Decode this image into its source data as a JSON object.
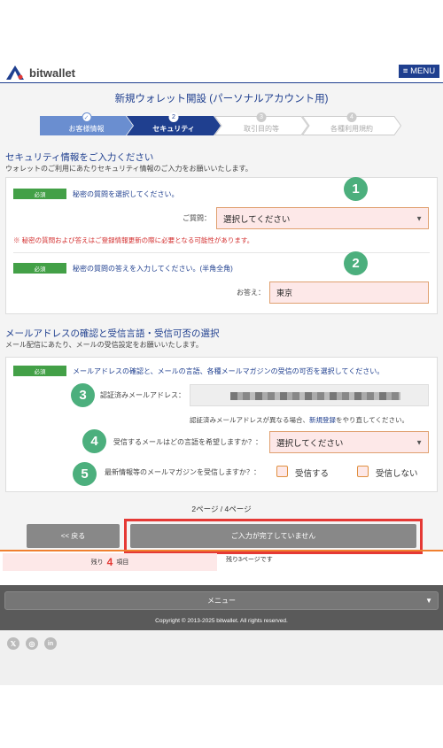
{
  "header": {
    "brand": "bitwallet",
    "menu_label": "≡ MENU"
  },
  "page_title": "新規ウォレット開設 (パーソナルアカウント用)",
  "steps": [
    {
      "num": "✓",
      "label": "お客様情報",
      "state": "done"
    },
    {
      "num": "2",
      "label": "セキュリティ",
      "state": "current"
    },
    {
      "num": "3",
      "label": "取引目的等",
      "state": "todo"
    },
    {
      "num": "4",
      "label": "各種利用規約",
      "state": "todo"
    }
  ],
  "security": {
    "title": "セキュリティ情報をご入力ください",
    "desc": "ウォレットのご利用にあたりセキュリティ情報のご入力をお願いいたします。",
    "q1": {
      "badge": "必須",
      "text": "秘密の質問を選択してください。",
      "label": "ご質問：",
      "select_value": "選択してください",
      "warning": "※ 秘密の質問および答えはご登録情報更新の際に必要となる可能性があります。",
      "marker": "1"
    },
    "q2": {
      "badge": "必須",
      "text": "秘密の質問の答えを入力してください。(半角全角)",
      "label": "お答え：",
      "value": "東京",
      "marker": "2"
    }
  },
  "mail": {
    "title": "メールアドレスの確認と受信言語・受信可否の選択",
    "desc": "メール配信にあたり、メールの受信設定をお願いいたします。",
    "badge": "必須",
    "text": "メールアドレスの確認と、メールの言語、各種メールマガジンの受信の可否を選択してください。",
    "email_label": "認証済みメールアドレス：",
    "email_note_pre": "認証済みメールアドレスが異なる場合、",
    "email_note_link": "新規登録",
    "email_note_post": "をやり直してください。",
    "lang_label": "受信するメールはどの言語を希望しますか？：",
    "lang_value": "選択してください",
    "mag_label": "最新情報等のメールマガジンを受信しますか？：",
    "opt_yes": "受信する",
    "opt_no": "受信しない",
    "markers": [
      "3",
      "4",
      "5"
    ]
  },
  "pagination": "2ページ / 4ページ",
  "buttons": {
    "back": "<< 戻る",
    "submit": "ご入力が完了していません"
  },
  "remaining": {
    "pre": "残り",
    "count": "4",
    "post": "項目",
    "right": "残り3ページです"
  },
  "footer": {
    "menu": "メニュー",
    "copyright": "Copyright © 2013-2025 bitwallet. All rights reserved."
  },
  "social": [
    "𝕏",
    "◎",
    "in"
  ],
  "colors": {
    "brand": "#1f3f8f",
    "required": "#43a047",
    "marker": "#4caf7d",
    "alert": "#e53935",
    "accent_orange": "#f08030"
  }
}
